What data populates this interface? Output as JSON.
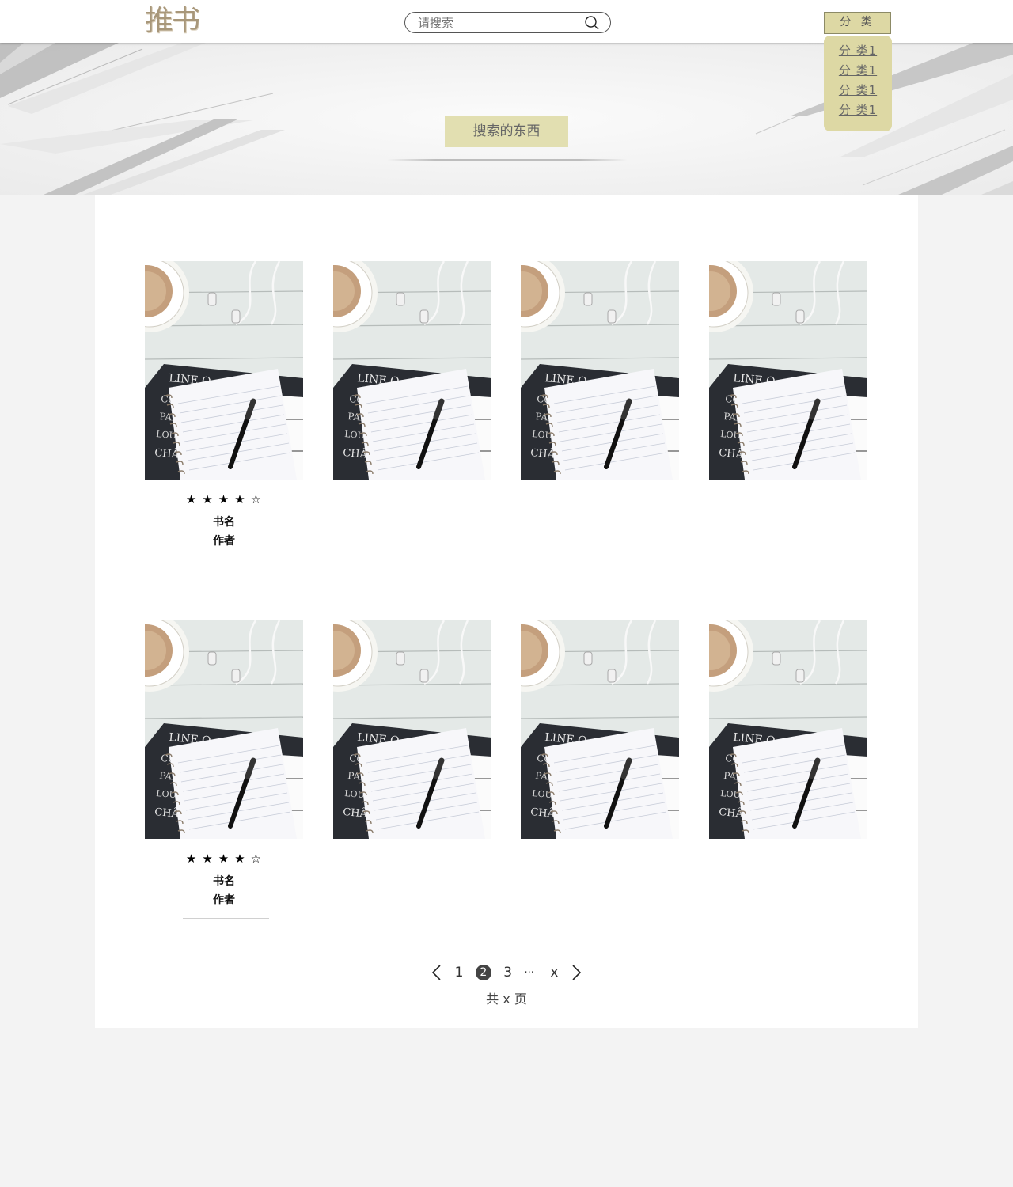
{
  "header": {
    "logo": "推书",
    "search_placeholder": "请搜索",
    "category_button": "分 类",
    "category_items": [
      "分 类1",
      "分 类1",
      "分 类1",
      "分 类1"
    ]
  },
  "hero": {
    "search_term": "搜索的东西"
  },
  "books": [
    {
      "stars": "★★★★☆",
      "title": "书名",
      "author": "作者"
    },
    {
      "stars": "",
      "title": "",
      "author": ""
    },
    {
      "stars": "",
      "title": "",
      "author": ""
    },
    {
      "stars": "",
      "title": "",
      "author": ""
    },
    {
      "stars": "★★★★☆",
      "title": "书名",
      "author": "作者"
    },
    {
      "stars": "",
      "title": "",
      "author": ""
    },
    {
      "stars": "",
      "title": "",
      "author": ""
    },
    {
      "stars": "",
      "title": "",
      "author": ""
    }
  ],
  "pagination": {
    "pages": [
      "1",
      "2",
      "3",
      "···",
      "x"
    ],
    "current": "2",
    "total": "共 x 页"
  },
  "colors": {
    "accent": "#ddd8a4",
    "logo": "#a8977a"
  },
  "icons": {
    "search": "search-icon",
    "prev": "chevron-left-icon",
    "next": "chevron-right-icon"
  }
}
